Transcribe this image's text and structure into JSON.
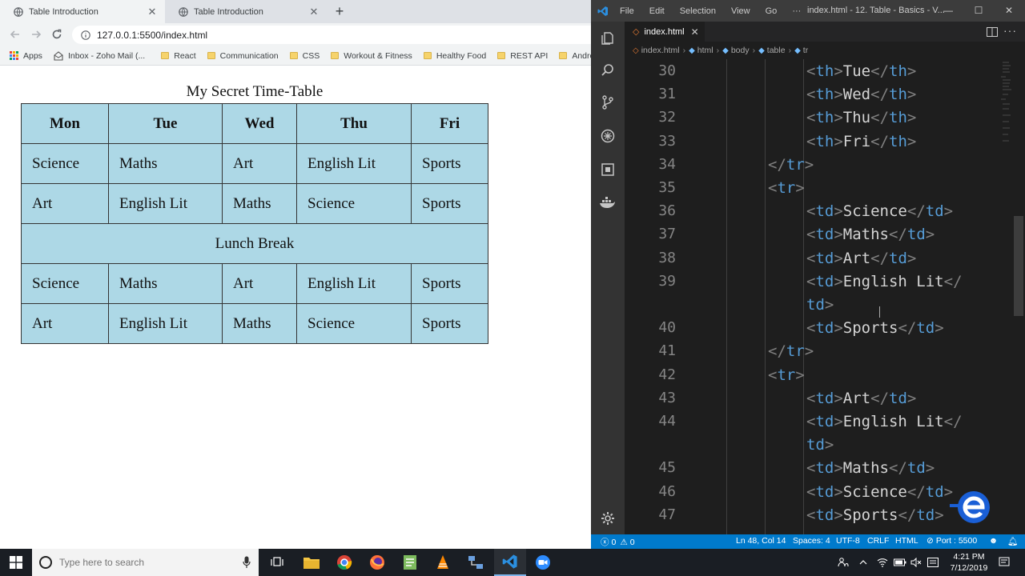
{
  "browser": {
    "tabs": [
      {
        "title": "Table Introduction",
        "active": true
      },
      {
        "title": "Table Introduction",
        "active": false
      }
    ],
    "url": "127.0.0.1:5500/index.html",
    "bookmarks": [
      {
        "label": "Apps",
        "icon": "apps-grid-icon"
      },
      {
        "label": "Inbox - Zoho Mail (...",
        "icon": "zoho-mail-icon"
      },
      {
        "label": "React",
        "icon": "folder-icon"
      },
      {
        "label": "Communication",
        "icon": "folder-icon"
      },
      {
        "label": "CSS",
        "icon": "folder-icon"
      },
      {
        "label": "Workout & Fitness",
        "icon": "folder-icon"
      },
      {
        "label": "Healthy Food",
        "icon": "folder-icon"
      },
      {
        "label": "REST API",
        "icon": "folder-icon"
      },
      {
        "label": "Andro",
        "icon": "folder-icon"
      }
    ]
  },
  "timetable": {
    "caption": "My Secret Time-Table",
    "headers": [
      "Mon",
      "Tue",
      "Wed",
      "Thu",
      "Fri"
    ],
    "rows": [
      [
        "Science",
        "Maths",
        "Art",
        "English Lit",
        "Sports"
      ],
      [
        "Art",
        "English Lit",
        "Maths",
        "Science",
        "Sports"
      ],
      [
        "Lunch Break"
      ],
      [
        "Science",
        "Maths",
        "Art",
        "English Lit",
        "Sports"
      ],
      [
        "Art",
        "English Lit",
        "Maths",
        "Science",
        "Sports"
      ]
    ],
    "background_color": "#add8e6"
  },
  "vscode": {
    "menu": [
      "File",
      "Edit",
      "Selection",
      "View",
      "Go",
      "···"
    ],
    "window_title": "index.html - 12. Table - Basics - V...",
    "open_file": "index.html",
    "breadcrumb": [
      "index.html",
      "html",
      "body",
      "table",
      "tr"
    ],
    "code_lines": [
      {
        "n": "30",
        "indent": 2,
        "segs": [
          [
            "p",
            "<"
          ],
          [
            "t",
            "th"
          ],
          [
            "p",
            ">"
          ],
          [
            "x",
            "Tue"
          ],
          [
            "p",
            "</"
          ],
          [
            "t",
            "th"
          ],
          [
            "p",
            ">"
          ]
        ]
      },
      {
        "n": "31",
        "indent": 2,
        "segs": [
          [
            "p",
            "<"
          ],
          [
            "t",
            "th"
          ],
          [
            "p",
            ">"
          ],
          [
            "x",
            "Wed"
          ],
          [
            "p",
            "</"
          ],
          [
            "t",
            "th"
          ],
          [
            "p",
            ">"
          ]
        ]
      },
      {
        "n": "32",
        "indent": 2,
        "segs": [
          [
            "p",
            "<"
          ],
          [
            "t",
            "th"
          ],
          [
            "p",
            ">"
          ],
          [
            "x",
            "Thu"
          ],
          [
            "p",
            "</"
          ],
          [
            "t",
            "th"
          ],
          [
            "p",
            ">"
          ]
        ]
      },
      {
        "n": "33",
        "indent": 2,
        "segs": [
          [
            "p",
            "<"
          ],
          [
            "t",
            "th"
          ],
          [
            "p",
            ">"
          ],
          [
            "x",
            "Fri"
          ],
          [
            "p",
            "</"
          ],
          [
            "t",
            "th"
          ],
          [
            "p",
            ">"
          ]
        ]
      },
      {
        "n": "34",
        "indent": 1,
        "segs": [
          [
            "p",
            "</"
          ],
          [
            "t",
            "tr"
          ],
          [
            "p",
            ">"
          ]
        ]
      },
      {
        "n": "35",
        "indent": 1,
        "segs": [
          [
            "p",
            "<"
          ],
          [
            "t",
            "tr"
          ],
          [
            "p",
            ">"
          ]
        ]
      },
      {
        "n": "36",
        "indent": 2,
        "segs": [
          [
            "p",
            "<"
          ],
          [
            "t",
            "td"
          ],
          [
            "p",
            ">"
          ],
          [
            "x",
            "Science"
          ],
          [
            "p",
            "</"
          ],
          [
            "t",
            "td"
          ],
          [
            "p",
            ">"
          ]
        ]
      },
      {
        "n": "37",
        "indent": 2,
        "segs": [
          [
            "p",
            "<"
          ],
          [
            "t",
            "td"
          ],
          [
            "p",
            ">"
          ],
          [
            "x",
            "Maths"
          ],
          [
            "p",
            "</"
          ],
          [
            "t",
            "td"
          ],
          [
            "p",
            ">"
          ]
        ]
      },
      {
        "n": "38",
        "indent": 2,
        "segs": [
          [
            "p",
            "<"
          ],
          [
            "t",
            "td"
          ],
          [
            "p",
            ">"
          ],
          [
            "x",
            "Art"
          ],
          [
            "p",
            "</"
          ],
          [
            "t",
            "td"
          ],
          [
            "p",
            ">"
          ]
        ]
      },
      {
        "n": "39",
        "indent": 2,
        "segs": [
          [
            "p",
            "<"
          ],
          [
            "t",
            "td"
          ],
          [
            "p",
            ">"
          ],
          [
            "x",
            "English Lit"
          ],
          [
            "p",
            "</"
          ]
        ]
      },
      {
        "n": "",
        "indent": 2,
        "segs": [
          [
            "t",
            "td"
          ],
          [
            "p",
            ">"
          ]
        ]
      },
      {
        "n": "40",
        "indent": 2,
        "segs": [
          [
            "p",
            "<"
          ],
          [
            "t",
            "td"
          ],
          [
            "p",
            ">"
          ],
          [
            "x",
            "Sports"
          ],
          [
            "p",
            "</"
          ],
          [
            "t",
            "td"
          ],
          [
            "p",
            ">"
          ]
        ]
      },
      {
        "n": "41",
        "indent": 1,
        "segs": [
          [
            "p",
            "</"
          ],
          [
            "t",
            "tr"
          ],
          [
            "p",
            ">"
          ]
        ]
      },
      {
        "n": "42",
        "indent": 1,
        "segs": [
          [
            "p",
            "<"
          ],
          [
            "t",
            "tr"
          ],
          [
            "p",
            ">"
          ]
        ]
      },
      {
        "n": "43",
        "indent": 2,
        "segs": [
          [
            "p",
            "<"
          ],
          [
            "t",
            "td"
          ],
          [
            "p",
            ">"
          ],
          [
            "x",
            "Art"
          ],
          [
            "p",
            "</"
          ],
          [
            "t",
            "td"
          ],
          [
            "p",
            ">"
          ]
        ]
      },
      {
        "n": "44",
        "indent": 2,
        "segs": [
          [
            "p",
            "<"
          ],
          [
            "t",
            "td"
          ],
          [
            "p",
            ">"
          ],
          [
            "x",
            "English Lit"
          ],
          [
            "p",
            "</"
          ]
        ]
      },
      {
        "n": "",
        "indent": 2,
        "segs": [
          [
            "t",
            "td"
          ],
          [
            "p",
            ">"
          ]
        ]
      },
      {
        "n": "45",
        "indent": 2,
        "segs": [
          [
            "p",
            "<"
          ],
          [
            "t",
            "td"
          ],
          [
            "p",
            ">"
          ],
          [
            "x",
            "Maths"
          ],
          [
            "p",
            "</"
          ],
          [
            "t",
            "td"
          ],
          [
            "p",
            ">"
          ]
        ]
      },
      {
        "n": "46",
        "indent": 2,
        "segs": [
          [
            "p",
            "<"
          ],
          [
            "t",
            "td"
          ],
          [
            "p",
            ">"
          ],
          [
            "x",
            "Science"
          ],
          [
            "p",
            "</"
          ],
          [
            "t",
            "td"
          ],
          [
            "p",
            ">"
          ]
        ]
      },
      {
        "n": "47",
        "indent": 2,
        "segs": [
          [
            "p",
            "<"
          ],
          [
            "t",
            "td"
          ],
          [
            "p",
            ">"
          ],
          [
            "x",
            "Sports"
          ],
          [
            "p",
            "</"
          ],
          [
            "t",
            "td"
          ],
          [
            "p",
            ">"
          ]
        ]
      }
    ],
    "status": {
      "errors": "0",
      "warnings": "0",
      "position": "Ln 48, Col 14",
      "spaces": "Spaces: 4",
      "encoding": "UTF-8",
      "eol": "CRLF",
      "language": "HTML",
      "port": "Port : 5500"
    },
    "colors": {
      "tag": "#569cd6",
      "punct": "#808080",
      "text": "#d4d4d4",
      "status": "#007acc"
    }
  },
  "taskbar": {
    "search_placeholder": "Type here to search",
    "time": "4:21 PM",
    "date": "7/12/2019",
    "apps": [
      "task-view-icon",
      "file-explorer-icon",
      "chrome-icon",
      "firefox-icon",
      "notepad-icon",
      "vlc-icon",
      "network-app-icon",
      "vscode-icon",
      "zoom-icon"
    ]
  }
}
